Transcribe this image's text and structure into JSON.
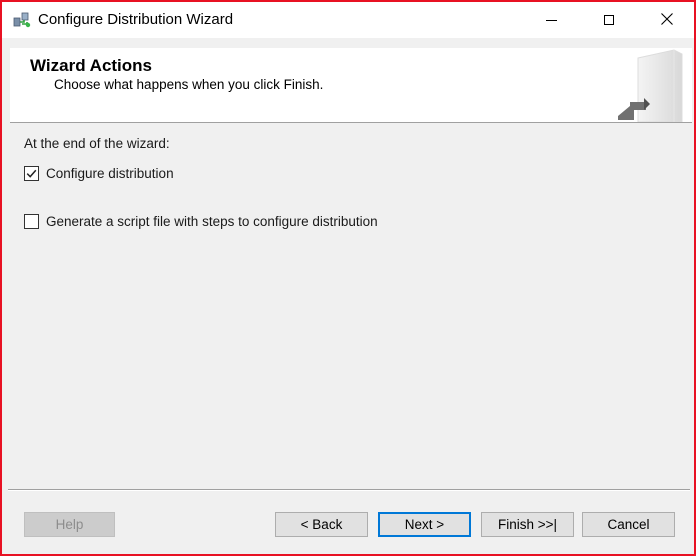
{
  "window": {
    "title": "Configure Distribution Wizard",
    "frame_color": "#e81123"
  },
  "titlebar_controls": {
    "minimize_icon": "minimize-icon",
    "maximize_icon": "maximize-icon",
    "close_icon": "close-icon"
  },
  "header": {
    "title": "Wizard Actions",
    "subtitle": "Choose what happens when you click Finish."
  },
  "content": {
    "label": "At the end of the wizard:",
    "options": [
      {
        "label": "Configure distribution",
        "checked": true
      },
      {
        "label": "Generate a script file with steps to configure distribution",
        "checked": false
      }
    ]
  },
  "footer": {
    "help_label": "Help",
    "back_label": "< Back",
    "next_label": "Next >",
    "finish_label": "Finish >>|",
    "cancel_label": "Cancel",
    "focus_color": "#0078d7"
  }
}
